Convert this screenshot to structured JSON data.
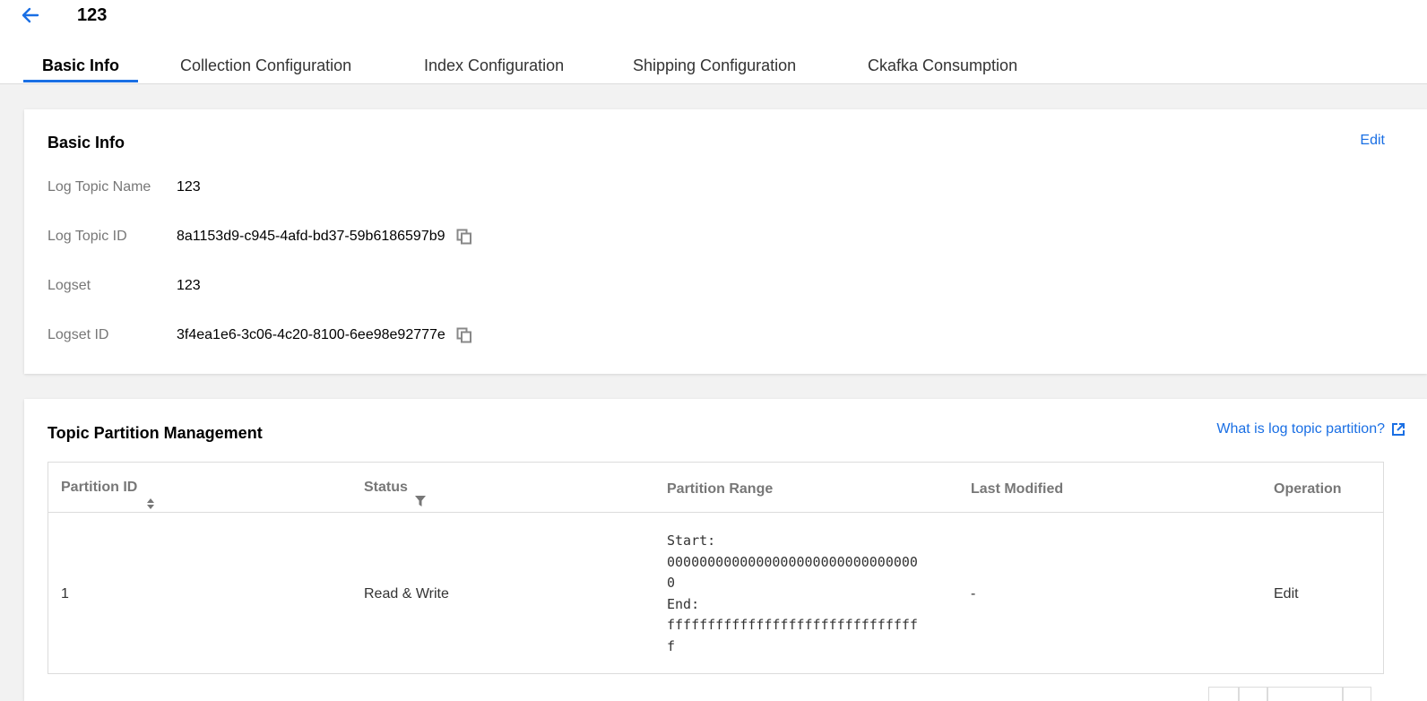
{
  "header": {
    "title": "123"
  },
  "tabs": [
    {
      "label": "Basic Info"
    },
    {
      "label": "Collection Configuration"
    },
    {
      "label": "Index Configuration"
    },
    {
      "label": "Shipping Configuration"
    },
    {
      "label": "Ckafka Consumption"
    }
  ],
  "basic_info": {
    "title": "Basic Info",
    "edit_label": "Edit",
    "fields": [
      {
        "label": "Log Topic Name",
        "value": "123"
      },
      {
        "label": "Log Topic ID",
        "value": "8a1153d9-c945-4afd-bd37-59b6186597b9"
      },
      {
        "label": "Logset",
        "value": "123"
      },
      {
        "label": "Logset ID",
        "value": "3f4ea1e6-3c06-4c20-8100-6ee98e92777e"
      }
    ]
  },
  "partitions": {
    "title": "Topic Partition Management",
    "help_link": "What is log topic partition?",
    "columns": [
      "Partition ID",
      "Status",
      "Partition Range",
      "Last Modified",
      "Operation"
    ],
    "rows": [
      {
        "id": "1",
        "status": "Read & Write",
        "range_start_label": "Start:",
        "range_start_line1": "0000000000000000000000000000000",
        "range_start_line2": "0",
        "range_end_label": "End:",
        "range_end_line1": "fffffffffffffffffffffffffffffff",
        "range_end_line2": "f",
        "last_modified": "-",
        "operation": "Edit"
      }
    ]
  },
  "colors": {
    "accent": "#1a6fe4",
    "label_gray": "#777777",
    "background": "#f2f2f2"
  }
}
